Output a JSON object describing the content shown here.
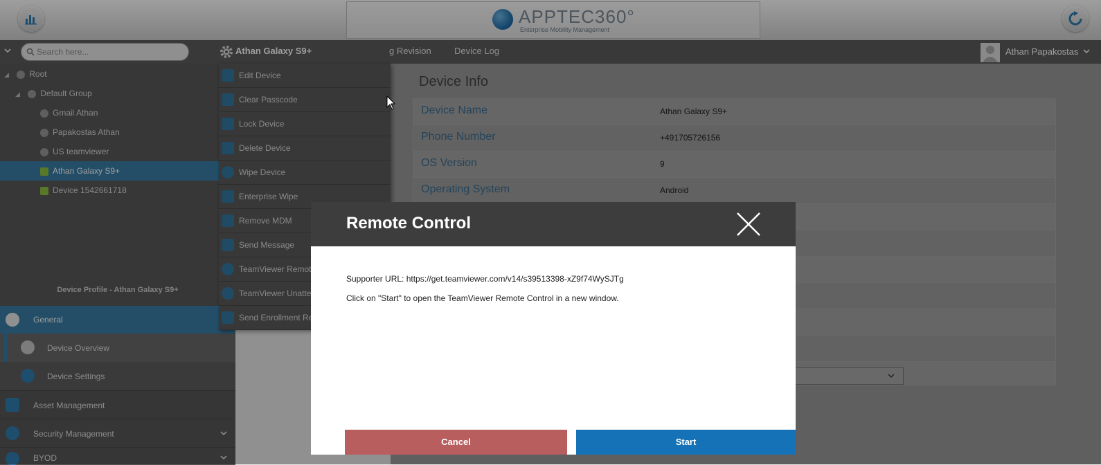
{
  "header": {
    "logo_main": "APPTEC360°",
    "logo_sub": "Enterprise Mobility Management"
  },
  "nav": {
    "search_placeholder": "Search here...",
    "device_title": "Athan Galaxy S9+",
    "tabs": [
      "g Revision",
      "Device Log"
    ],
    "user_name": "Athan Papakostas"
  },
  "tree": {
    "items": [
      {
        "label": "Root"
      },
      {
        "label": "Default Group"
      },
      {
        "label": "Gmail Athan"
      },
      {
        "label": "Papakostas Athan"
      },
      {
        "label": "US teamviewer"
      },
      {
        "label": "Athan Galaxy S9+"
      },
      {
        "label": "Device 1542661718"
      }
    ]
  },
  "profile": {
    "label": "Device Profile - Athan Galaxy S9+",
    "menu": [
      {
        "label": "General"
      },
      {
        "label": "Device Overview"
      },
      {
        "label": "Device Settings"
      },
      {
        "label": "Asset Management"
      },
      {
        "label": "Security Management"
      },
      {
        "label": "BYOD"
      }
    ]
  },
  "actions": {
    "items": [
      {
        "label": "Edit Device"
      },
      {
        "label": "Clear Passcode"
      },
      {
        "label": "Lock Device"
      },
      {
        "label": "Delete Device"
      },
      {
        "label": "Wipe Device"
      },
      {
        "label": "Enterprise Wipe"
      },
      {
        "label": "Remove MDM"
      },
      {
        "label": "Send Message"
      },
      {
        "label": "TeamViewer Remote"
      },
      {
        "label": "TeamViewer Unatte"
      },
      {
        "label": "Send Enrollment Re"
      }
    ]
  },
  "device_info": {
    "title": "Device Info",
    "rows": [
      {
        "label": "Device Name",
        "value": "Athan Galaxy S9+"
      },
      {
        "label": "Phone Number",
        "value": "+491705726156"
      },
      {
        "label": "OS Version",
        "value": "9"
      },
      {
        "label": "Operating System",
        "value": "Android"
      }
    ]
  },
  "modal": {
    "title": "Remote Control",
    "url_label": "Supporter URL:",
    "url": "https://get.teamviewer.com/v14/s39513398-xZ9f74WySJTg",
    "info": "Click on \"Start\" to open the TeamViewer Remote Control in a new window.",
    "cancel_label": "Cancel",
    "start_label": "Start"
  },
  "colors": {
    "accent": "#1672b6",
    "cancel": "#b85e5e",
    "selected_row": "#3a7ea7"
  }
}
